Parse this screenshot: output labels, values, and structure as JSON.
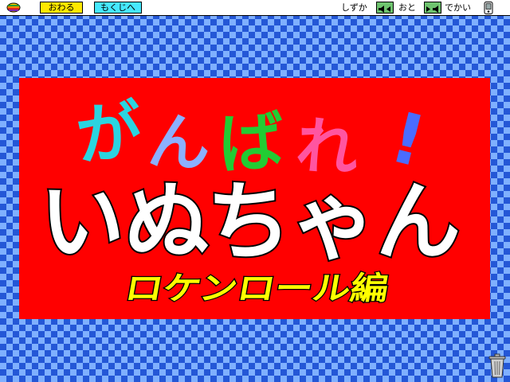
{
  "menubar": {
    "quit_label": "おわる",
    "toc_label": "もくじへ",
    "quiet_label": "しずか",
    "sound_label": "おと",
    "loud_label": "でかい",
    "icons": {
      "apple": "apple-logo-icon",
      "vol_down": "speaker-quieter-icon",
      "vol_up": "speaker-louder-icon",
      "device": "handheld-device-icon"
    }
  },
  "title": {
    "line1_chars": [
      "が",
      "ん",
      "ば",
      "れ",
      "!"
    ],
    "line1_colors": [
      "#2bd4e0",
      "#8cb0ff",
      "#22cc33",
      "#ff55a0",
      "#4a6cff"
    ],
    "line2": "いぬちゃん",
    "line2_color": "#ffffff",
    "subtitle": "ロケンロール編",
    "subtitle_color": "#ffff00",
    "card_color": "#ff0000"
  },
  "trash": {
    "icon": "trash-can-icon"
  }
}
